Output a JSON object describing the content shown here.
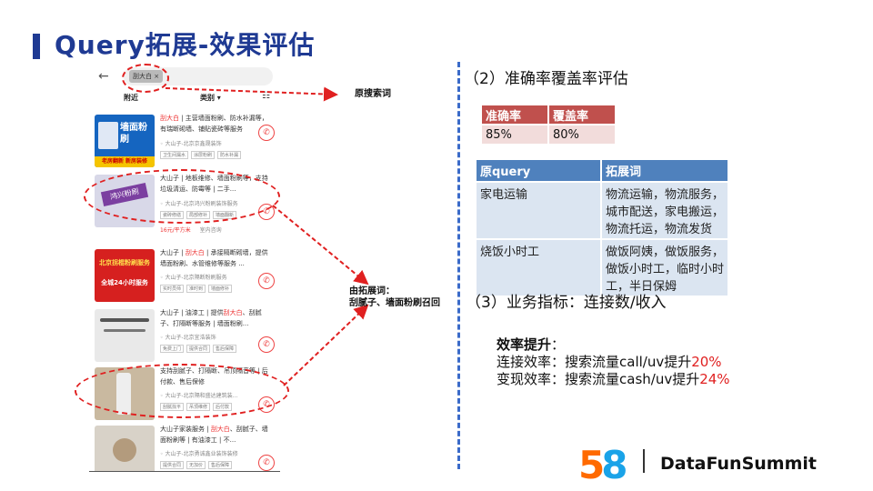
{
  "slide": {
    "title": "Query拓展-效果评估"
  },
  "phone": {
    "back_icon": "←",
    "search_tag": "刮大白 ×",
    "filters": {
      "nearby": "附近",
      "category": "类别 ▾"
    },
    "filter_icon": "☷",
    "listings": [
      {
        "thumb_text": "墙面粉刷",
        "thumb_caption": "老房翻新 新房装修",
        "text_pre": "刮大白",
        "text_rest": " | 主营墙面粉刷、防水补漏等，有瑞断砌墙、铺贴瓷砖等服务",
        "location": "大山子-北京京鑫晟装饰",
        "badges": [
          "卫生间漏水",
          "涂层粉刷",
          "防水补漏"
        ]
      },
      {
        "thumb_text": "鸿兴粉刷",
        "thumb_caption": "",
        "text_pre": "大山子 | 地板维修、墙面粉刷等，支持垃圾清运、防霉等 | 二手...",
        "text_rest": "",
        "location": "大山子-北京鸿兴粉刷装饰服务",
        "badges": [
          "瓷砖修缮",
          "局部修补",
          "墙面翻新"
        ],
        "price": "16元/平方米",
        "price_note": "室内咨询"
      },
      {
        "thumb_text": "北京拐棍粉刷服务",
        "thumb_caption": "全城24小时服务",
        "text_pre": "大山子 | ",
        "text_hl": "刮大白",
        "text_rest": " | 承接隔断砌墙，提供墙面粉刷、水管维修等服务 ...",
        "location": "大山子-北京隔断粉刷服务",
        "badges": [
          "实时员师",
          "准时到",
          "墙面修补"
        ]
      },
      {
        "thumb_text": "",
        "thumb_caption": "",
        "text_pre": "大山子 | 油漆工 | 提供",
        "text_hl": "刮大白",
        "text_rest": "、刮腻子、打隔断等服务 | 墙面粉刷...",
        "location": "大山子-北京宜浩装饰",
        "badges": [
          "免费上门",
          "提供合同",
          "售后保障"
        ]
      },
      {
        "thumb_text": "",
        "thumb_caption": "",
        "text_pre": "支持刮腻子、打隔断、吊顶隔音等 | 后付款、售后保修",
        "text_rest": "",
        "location": "大山子-北京隔和盛达建筑装...",
        "badges": [
          "刮腻找平",
          "吊顶维修",
          "后付款"
        ]
      },
      {
        "thumb_text": "",
        "thumb_caption": "",
        "text_pre": "大山子家装服务 | ",
        "text_hl": "刮大白",
        "text_rest": "、刮腻子、墙面粉刷等 | 有油漆工 | 不...",
        "location": "大山子-北京勇诚鑫业装饰装修",
        "badges": [
          "提供合同",
          "无加价",
          "售后保障"
        ]
      }
    ],
    "phone_icon": "✆"
  },
  "annotations": {
    "original_query": "原搜索词",
    "expanded_line1": "由拓展词：",
    "expanded_line2": "刮腻子、墙面粉刷召回"
  },
  "right": {
    "section2": "（2）准确率覆盖率评估",
    "table1": {
      "headers": [
        "准确率",
        "覆盖率"
      ],
      "values": [
        "85%",
        "80%"
      ]
    },
    "table2": {
      "headers": [
        "原query",
        "拓展词"
      ],
      "rows": [
        {
          "query": "家电运输",
          "expansions": "物流运输，物流服务，城市配送，家电搬运，物流托运，物流发货"
        },
        {
          "query": "烧饭小时工",
          "expansions": "做饭阿姨，做饭服务，做饭小时工，临时小时工，半日保姆"
        }
      ]
    },
    "section3": "（3）业务指标：连接数/收入",
    "efficiency": {
      "title": "效率提升",
      "colon": "：",
      "line1_text": "连接效率：搜索流量call/uv提升",
      "line1_value": "20%",
      "line2_text": "变现效率：搜索流量cash/uv提升",
      "line2_value": "24%"
    }
  },
  "footer": {
    "logo_5": "5",
    "logo_8": "8",
    "brand": "DataFunSummit"
  },
  "colors": {
    "title": "#1f3a93",
    "red_highlight": "#e02020",
    "table1_header": "#c0504d",
    "table2_header": "#4f81bd"
  }
}
